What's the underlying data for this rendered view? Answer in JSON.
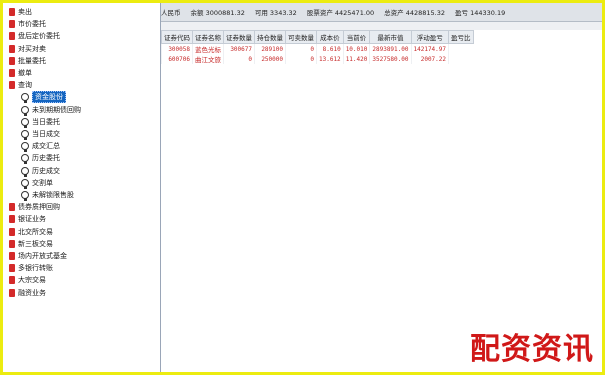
{
  "tree": [
    {
      "label": "卖出",
      "icon": "red-square-icon",
      "level": 0
    },
    {
      "label": "市价委托",
      "icon": "red-square-icon",
      "level": 0
    },
    {
      "label": "盘后定价委托",
      "icon": "red-square-icon",
      "level": 0
    },
    {
      "label": "对买对卖",
      "icon": "red-square-icon",
      "level": 0
    },
    {
      "label": "批量委托",
      "icon": "red-square-icon",
      "level": 0
    },
    {
      "label": "撤单",
      "icon": "red-square-icon",
      "level": 0
    },
    {
      "label": "查询",
      "icon": "red-square-icon",
      "level": 0
    },
    {
      "label": "资金股份",
      "icon": "stamp-icon",
      "level": 1,
      "selected": true
    },
    {
      "label": "未到期期债回购",
      "icon": "stamp-icon",
      "level": 1
    },
    {
      "label": "当日委托",
      "icon": "stamp-icon",
      "level": 1
    },
    {
      "label": "当日成交",
      "icon": "stamp-icon",
      "level": 1
    },
    {
      "label": "成交汇总",
      "icon": "stamp-icon",
      "level": 1
    },
    {
      "label": "历史委托",
      "icon": "stamp-icon",
      "level": 1
    },
    {
      "label": "历史成交",
      "icon": "stamp-icon",
      "level": 1
    },
    {
      "label": "交割单",
      "icon": "stamp-icon",
      "level": 1
    },
    {
      "label": "未解锁限售股",
      "icon": "stamp-icon",
      "level": 1
    },
    {
      "label": "债券质押回购",
      "icon": "red-square-icon",
      "level": 0
    },
    {
      "label": "银证业务",
      "icon": "red-square-icon",
      "level": 0
    },
    {
      "label": "北交所交易",
      "icon": "red-square-icon",
      "level": 0
    },
    {
      "label": "新三板交易",
      "icon": "red-square-icon",
      "level": 0
    },
    {
      "label": "场内开放式基金",
      "icon": "red-square-icon",
      "level": 0
    },
    {
      "label": "多银行转账",
      "icon": "red-square-icon",
      "level": 0
    },
    {
      "label": "大宗交易",
      "icon": "red-square-icon",
      "level": 0
    },
    {
      "label": "融资业务",
      "icon": "red-square-icon",
      "level": 0
    }
  ],
  "summary": {
    "currency": "人民币",
    "balance": "余额 3000881.32",
    "available": "可用 3343.32",
    "assets": "股票资产 4425471.00",
    "total": "总资产 4428815.32",
    "account": "盈亏 144330.19"
  },
  "table": {
    "headers": [
      "证券代码",
      "证券名称",
      "证券数量",
      "持仓数量",
      "可卖数量",
      "成本价",
      "当前价",
      "最新市值",
      "浮动盈亏",
      "盈亏比"
    ],
    "rows": [
      [
        "300058",
        "蓝色光标",
        "300677",
        "289100",
        "0",
        "8.610",
        "10.010",
        "2893891.00",
        "142174.97",
        ""
      ],
      [
        "600706",
        "曲江文旅",
        "0",
        "250000",
        "0",
        "13.612",
        "11.420",
        "3527580.00",
        "2007.22",
        ""
      ]
    ]
  },
  "watermark": "配资资讯",
  "colors": {
    "frame": "#ecec10",
    "selected": "#1565c0",
    "value": "#c62828",
    "watermark": "#d01818"
  }
}
